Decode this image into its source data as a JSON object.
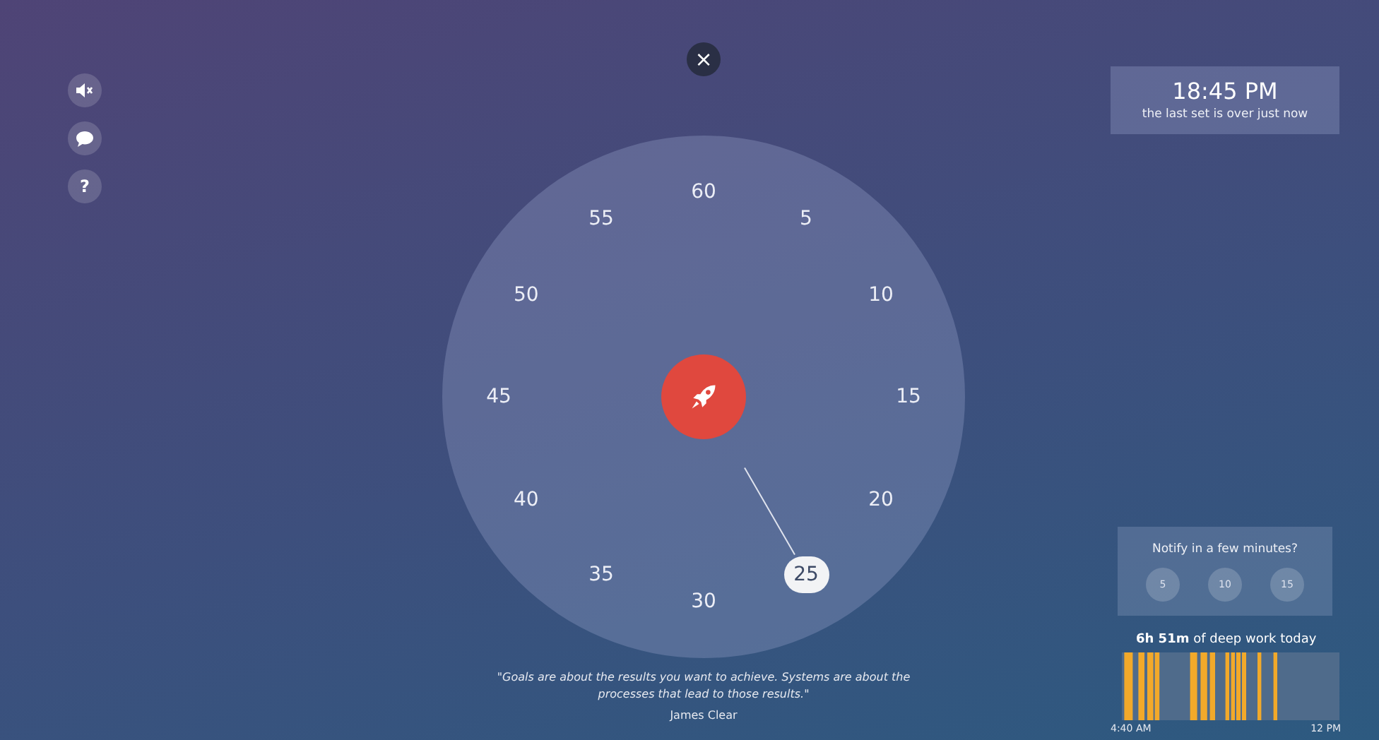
{
  "side_buttons": [
    {
      "kind": "mute"
    },
    {
      "kind": "chat"
    },
    {
      "kind": "help",
      "label": "?"
    }
  ],
  "close_button": {
    "label": "×"
  },
  "dial": {
    "marks": [
      {
        "label": "60",
        "selected": false
      },
      {
        "label": "5",
        "selected": false
      },
      {
        "label": "10",
        "selected": false
      },
      {
        "label": "15",
        "selected": false
      },
      {
        "label": "20",
        "selected": false
      },
      {
        "label": "25",
        "selected": true
      },
      {
        "label": "30",
        "selected": false
      },
      {
        "label": "35",
        "selected": false
      },
      {
        "label": "40",
        "selected": false
      },
      {
        "label": "45",
        "selected": false
      },
      {
        "label": "50",
        "selected": false
      },
      {
        "label": "55",
        "selected": false
      }
    ]
  },
  "quote": {
    "text": "\"Goals are about the results you want to achieve. Systems are about the processes that lead to those results.\"",
    "author": "James Clear"
  },
  "clock": {
    "time": "18:45 PM",
    "note": "the last set is over just now"
  },
  "notify": {
    "title": "Notify in a few minutes?",
    "options": [
      "5",
      "10",
      "15"
    ]
  },
  "deep_work": {
    "summary": "**6h 51m** of deep work today",
    "start": "4:40 AM",
    "end": "12 PM"
  }
}
